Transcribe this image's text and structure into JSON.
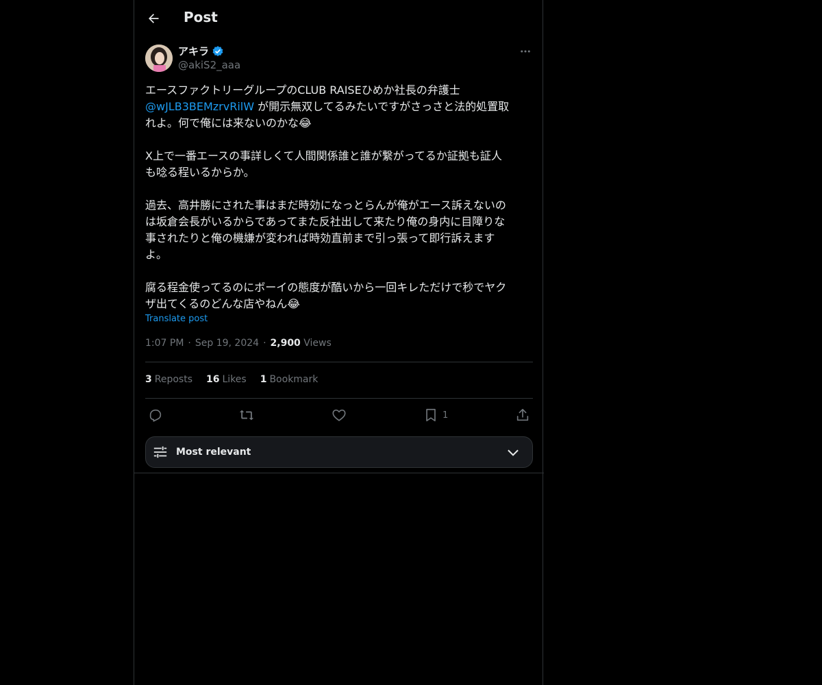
{
  "header": {
    "title": "Post"
  },
  "author": {
    "display_name": "アキラ",
    "handle": "@akiS2_aaa",
    "verified": true
  },
  "post": {
    "line1": "エースファクトリーグループのCLUB RAISEひめか社長の弁護士",
    "mention": "@wJLB3BEMzrvRilW",
    "line2": " が開示無双してるみたいですがさっさと法的処置取",
    "line3": "れよ。何で俺には来ないのかな😂",
    "para2": "X上で一番エースの事詳しくて人間関係誰と誰が繋がってるか証拠も証人\nも唸る程いるからか。",
    "para3": "過去、高井勝にされた事はまだ時効になっとらんが俺がエース訴えないの\nは坂倉会長がいるからであってまた反社出して来たり俺の身内に目障りな\n事されたりと俺の機嫌が変われば時効直前まで引っ張って即行訴えます\nよ。",
    "para4": "腐る程金使ってるのにボーイの態度が酷いから一回キレただけで秒でヤク\nザ出てくるのどんな店やねん😂",
    "translate_label": "Translate post"
  },
  "meta": {
    "time": "1:07 PM",
    "date": "Sep 19, 2024",
    "separator": "·",
    "views_count": "2,900",
    "views_label": "Views"
  },
  "stats": {
    "reposts_count": "3",
    "reposts_label": "Reposts",
    "likes_count": "16",
    "likes_label": "Likes",
    "bookmarks_count": "1",
    "bookmarks_label": "Bookmark"
  },
  "actions": {
    "bookmark_count": "1"
  },
  "sort": {
    "label": "Most relevant"
  },
  "colors": {
    "accent": "#1d9bf0",
    "text": "#e7e9ea",
    "muted": "#71767b",
    "border": "#2f3336"
  }
}
